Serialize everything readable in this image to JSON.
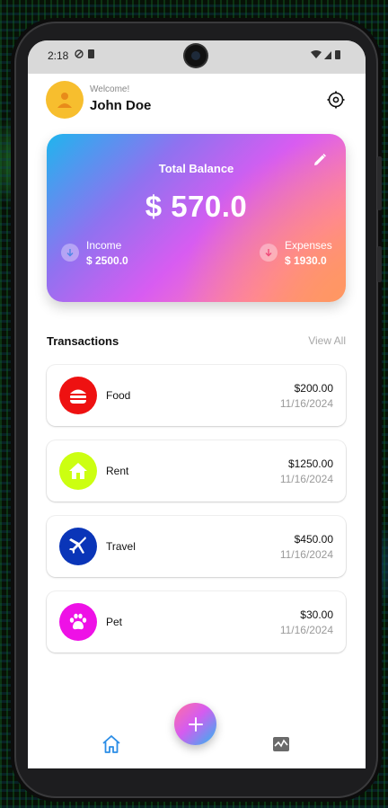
{
  "status_bar": {
    "time": "2:18"
  },
  "header": {
    "welcome": "Welcome!",
    "username": "John Doe"
  },
  "balance_card": {
    "title": "Total Balance",
    "balance": "$ 570.0",
    "income": {
      "label": "Income",
      "value": "$ 2500.0"
    },
    "expenses": {
      "label": "Expenses",
      "value": "$ 1930.0"
    }
  },
  "transactions": {
    "title": "Transactions",
    "view_all": "View All",
    "items": [
      {
        "name": "Food",
        "amount": "$200.00",
        "date": "11/16/2024",
        "icon": "burger-icon",
        "color": "#ee1111"
      },
      {
        "name": "Rent",
        "amount": "$1250.00",
        "date": "11/16/2024",
        "icon": "house-icon",
        "color": "#ccff11"
      },
      {
        "name": "Travel",
        "amount": "$450.00",
        "date": "11/16/2024",
        "icon": "airplane-icon",
        "color": "#0a35b8"
      },
      {
        "name": "Pet",
        "amount": "$30.00",
        "date": "11/16/2024",
        "icon": "paw-icon",
        "color": "#ee11e6"
      }
    ]
  },
  "nav": {
    "items": [
      "home-icon",
      "stats-icon"
    ],
    "active": "home-icon"
  },
  "colors": {
    "accent": "#2b8de6",
    "avatar": "#f7be2e"
  }
}
